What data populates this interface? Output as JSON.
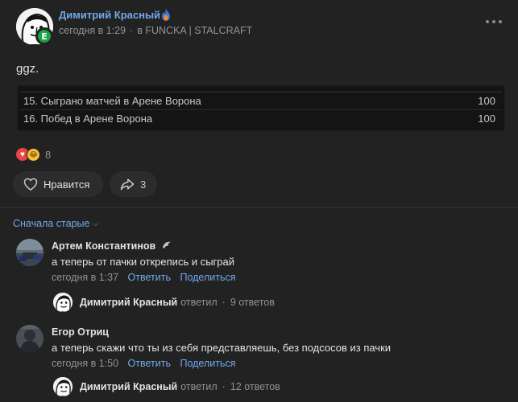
{
  "post": {
    "author": "Димитрий Красный",
    "time": "сегодня в 1:29",
    "source": "в FUNCKA | STALCRAFT",
    "text": "ggz.",
    "table_rows": [
      {
        "label": "15. Сыграно матчей в Арене Ворона",
        "value": "100"
      },
      {
        "label": "16. Побед в Арене Ворона",
        "value": "100"
      }
    ],
    "reaction_count": "8",
    "like_label": "Нравится",
    "share_count": "3"
  },
  "sort_label": "Сначала старые",
  "comments": [
    {
      "author": "Артем Константинов",
      "text": "а теперь от пачки открепись и сыграй",
      "time": "сегодня в 1:37",
      "reply_link": "Ответить",
      "share_link": "Поделиться",
      "reply_summary": {
        "name": "Димитрий Красный",
        "verb": "ответил",
        "count": "9 ответов"
      }
    },
    {
      "author": "Егор Отриц",
      "text": "а теперь скажи что ты из себя представляешь, без подсосов из пачки",
      "time": "сегодня в 1:50",
      "reply_link": "Ответить",
      "share_link": "Поделиться",
      "reply_summary": {
        "name": "Димитрий Красный",
        "verb": "ответил",
        "count": "12 ответов"
      }
    }
  ],
  "colors": {
    "link": "#71aaeb",
    "background": "#222222",
    "secondary_text": "#939393",
    "heart": "#e64646",
    "badge": "#1aa34a"
  },
  "icons": [
    "fire-icon",
    "more-icon",
    "heart-outline-icon",
    "share-arrow-icon",
    "chevron-down-icon",
    "heart-reaction-icon",
    "laugh-reaction-icon",
    "shadow-icon"
  ]
}
